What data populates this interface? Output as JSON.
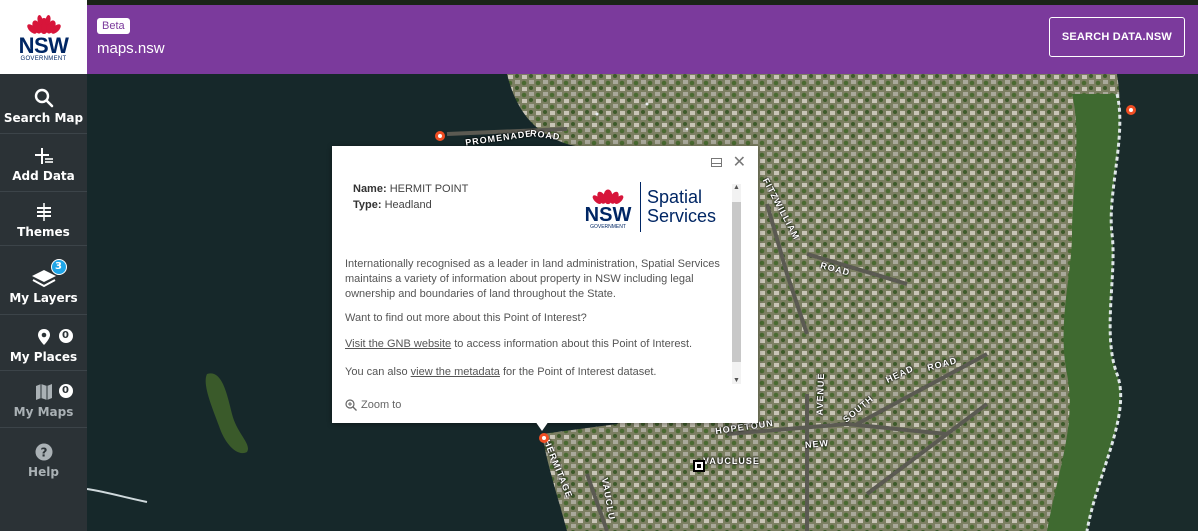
{
  "sidebar": {
    "logo": {
      "text": "NSW",
      "subtext": "GOVERNMENT"
    },
    "items": [
      {
        "label": "Search Map",
        "icon": "search-icon"
      },
      {
        "label": "Add Data",
        "icon": "add-data-icon"
      },
      {
        "label": "Themes",
        "icon": "themes-icon"
      },
      {
        "label": "My Layers",
        "icon": "layers-icon",
        "badge": "3"
      },
      {
        "label": "My Places",
        "icon": "place-pin-icon",
        "badge": "0"
      },
      {
        "label": "My Maps",
        "icon": "map-icon",
        "badge": "0"
      },
      {
        "label": "Help",
        "icon": "help-icon"
      }
    ]
  },
  "header": {
    "badge": "Beta",
    "title": "maps.nsw",
    "search_button": "SEARCH DATA.NSW",
    "color": "#7b3a9c"
  },
  "map": {
    "road_labels": [
      "PROMENADE",
      "ROAD",
      "FITZWILLIAM",
      "ROAD",
      "HOPETOUN",
      "AVENUE",
      "NEW",
      "SOUTH",
      "HEAD",
      "ROAD",
      "VAUCLUSE",
      "HERMITAGE",
      "VAUCLU"
    ]
  },
  "popup": {
    "name_label": "Name:",
    "name_value": "HERMIT POINT",
    "type_label": "Type:",
    "type_value": "Headland",
    "logo_nsw": "NSW",
    "logo_gov": "GOVERNMENT",
    "logo_line1": "Spatial",
    "logo_line2": "Services",
    "description": "Internationally recognised as a leader in land administration, Spatial Services maintains a variety of information about property in NSW including legal ownership and boundaries of land throughout the State.",
    "question": "Want to find out more about this Point of Interest?",
    "gnb_link": "Visit the GNB website",
    "gnb_suffix": " to access information about this Point of Interest.",
    "meta_prefix": "You can also ",
    "meta_link": "view the metadata",
    "meta_suffix": " for the Point of Interest dataset.",
    "zoom_to": "Zoom to"
  }
}
